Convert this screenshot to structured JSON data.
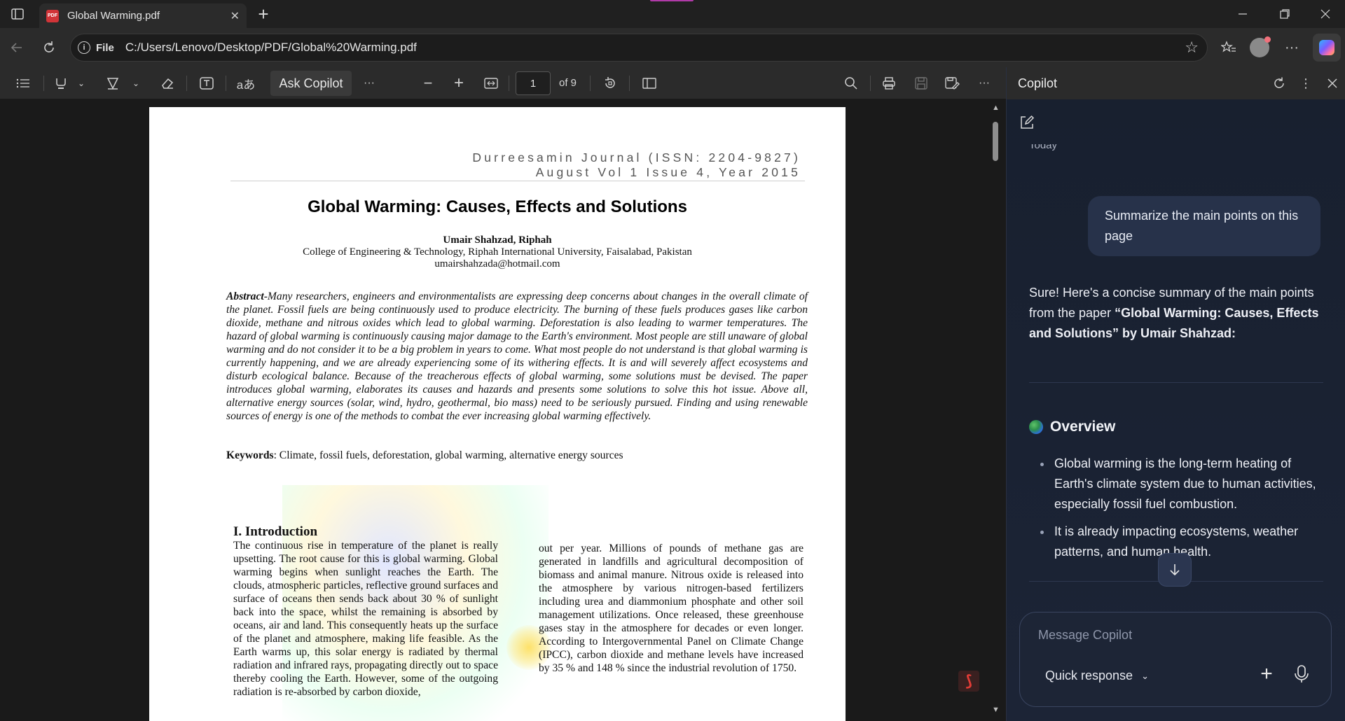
{
  "tabstrip": {
    "tab_title": "Global Warming.pdf",
    "pdf_badge": "PDF"
  },
  "address": {
    "scheme": "File",
    "url": "C:/Users/Lenovo/Desktop/PDF/Global%20Warming.pdf"
  },
  "pdf_toolbar": {
    "ask_copilot": "Ask Copilot",
    "page_current": "1",
    "page_total": "of 9"
  },
  "document": {
    "journal_line1": "Durreesamin Journal (ISSN: 2204-9827)",
    "journal_line2": "August Vol 1 Issue 4, Year 2015",
    "title": "Global Warming: Causes, Effects and Solutions",
    "author": "Umair Shahzad, Riphah",
    "affiliation": "College of Engineering & Technology, Riphah International University, Faisalabad, Pakistan",
    "email": "umairshahzada@hotmail.com",
    "abstract_label": "Abstract",
    "abstract_text": "-Many researchers, engineers and environmentalists are expressing deep concerns about changes in the overall climate of the planet. Fossil fuels are being continuously used to produce electricity. The burning of these fuels produces gases like carbon dioxide, methane and nitrous oxides which lead to global warming. Deforestation is also leading to warmer temperatures. The hazard of global warming is continuously causing major damage to the Earth's environment. Most people are still unaware of global warming and do not consider it to be a big problem in years to come. What most people do not understand is that global warming is currently happening, and we are already experiencing some of its withering effects. It is and will severely affect ecosystems and disturb ecological balance. Because of the treacherous effects of global warming, some solutions must be devised. The paper introduces global warming, elaborates its causes and hazards and presents some solutions to solve this hot issue. Above all, alternative energy sources (solar, wind, hydro, geothermal, bio mass) need to be seriously pursued. Finding and using renewable sources of energy is one of the methods to combat the ever increasing global warming effectively.",
    "keywords_label": "Keywords",
    "keywords_text": ": Climate, fossil fuels, deforestation, global warming, alternative energy sources",
    "intro_heading": "I. Introduction",
    "intro_col1": "The continuous rise in temperature of the planet is really upsetting. The root cause for this is global warming.  Global warming begins when sunlight reaches the Earth. The clouds, atmospheric particles, reflective ground surfaces and surface of oceans then sends back about 30 % of sunlight back into the space, whilst the remaining is absorbed by oceans, air and land. This consequently heats up the surface of the planet and atmosphere, making life feasible. As the Earth warms up, this solar energy is radiated by thermal radiation and infrared rays, propagating directly out to space thereby cooling the Earth. However, some of the outgoing radiation is re-absorbed by carbon dioxide,",
    "intro_col2": "out per year. Millions of pounds of methane gas are generated in landfills and agricultural decomposition of biomass and animal manure. Nitrous oxide is released into the atmosphere by various nitrogen-based fertilizers including urea and diammonium phosphate and other soil management utilizations. Once released, these greenhouse gases stay in the atmosphere for decades or even longer. According to Intergovernmental Panel on Climate Change (IPCC), carbon dioxide and methane levels have increased by 35 % and 148 % since the industrial revolution of 1750."
  },
  "copilot": {
    "header_title": "Copilot",
    "today_label": "Today",
    "user_message": "Summarize the main points on this page",
    "reply_intro": "Sure! Here's a concise summary of the main points from the paper ",
    "reply_bold": "“Global Warming: Causes, Effects and Solutions” by Umair Shahzad",
    "reply_end": ":",
    "section_heading": "Overview",
    "bullets": [
      "Global warming is the long-term heating of Earth's climate system due to human activities, especially fossil fuel combustion.",
      "It is already impacting ecosystems, weather patterns, and human health."
    ],
    "composer_placeholder": "Message Copilot",
    "quick_response": "Quick response"
  }
}
